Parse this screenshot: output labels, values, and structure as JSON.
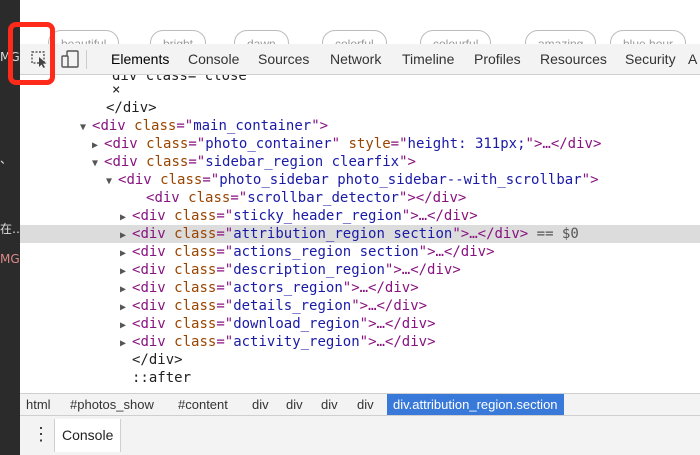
{
  "page": {
    "left_fragments": [
      "MG",
      "、",
      "在…",
      "MG"
    ],
    "tags": [
      "beautiful",
      "bright",
      "dawn",
      "colorful",
      "colourful",
      "amazing",
      "blue hour"
    ]
  },
  "toolbar": {
    "inspect_icon": "inspect-element-icon",
    "device_icon": "device-toggle-icon",
    "tabs": [
      "Elements",
      "Console",
      "Sources",
      "Network",
      "Timeline",
      "Profiles",
      "Resources",
      "Security",
      "A"
    ]
  },
  "tree": {
    "rows": [
      {
        "tri": "",
        "text": "div class=\"close\""
      },
      {
        "tri": "",
        "text": "×"
      },
      {
        "tri": "",
        "text": "</div>"
      },
      {
        "tri": "▼",
        "tag": "div",
        "attr": "class",
        "val": "main_container",
        "rest": ">"
      },
      {
        "tri": "▶",
        "tag": "div",
        "attr": "class",
        "val": "photo_container",
        "attr2": "style",
        "val2": "height: 311px;",
        "rest": ">…</div>"
      },
      {
        "tri": "▼",
        "tag": "div",
        "attr": "class",
        "val": "sidebar_region clearfix",
        "rest": ">"
      },
      {
        "tri": "▼",
        "tag": "div",
        "attr": "class",
        "val": "photo_sidebar photo_sidebar--with_scrollbar",
        "rest": ">"
      },
      {
        "tri": "",
        "tag": "div",
        "attr": "class",
        "val": "scrollbar_detector",
        "rest": "></div>"
      },
      {
        "tri": "▶",
        "tag": "div",
        "attr": "class",
        "val": "sticky_header_region",
        "rest": ">…</div>"
      },
      {
        "tri": "▶",
        "tag": "div",
        "attr": "class",
        "val": "attribution_region section",
        "rest": ">…</div>",
        "suffix": " == $0"
      },
      {
        "tri": "▶",
        "tag": "div",
        "attr": "class",
        "val": "actions_region section",
        "rest": ">…</div>"
      },
      {
        "tri": "▶",
        "tag": "div",
        "attr": "class",
        "val": "description_region",
        "rest": ">…</div>"
      },
      {
        "tri": "▶",
        "tag": "div",
        "attr": "class",
        "val": "actors_region",
        "rest": ">…</div>"
      },
      {
        "tri": "▶",
        "tag": "div",
        "attr": "class",
        "val": "details_region",
        "rest": ">…</div>"
      },
      {
        "tri": "▶",
        "tag": "div",
        "attr": "class",
        "val": "download_region",
        "rest": ">…</div>"
      },
      {
        "tri": "▶",
        "tag": "div",
        "attr": "class",
        "val": "activity_region",
        "rest": ">…</div>"
      },
      {
        "tri": "",
        "text": "</div>"
      },
      {
        "tri": "",
        "text": "::after"
      }
    ],
    "selected_index": 9
  },
  "breadcrumbs": [
    "html",
    "#photos_show",
    "#content",
    "div",
    "div",
    "div",
    "div",
    "div.attribution_region.section"
  ],
  "drawer": {
    "menu_icon": "vertical-ellipsis-icon",
    "tab_label": "Console"
  },
  "colors": {
    "highlight": "#ff2a1a",
    "selected_crumb": "#3879d9",
    "tag": "#881280",
    "attr_name": "#994500",
    "attr_value": "#1a1aa6"
  }
}
